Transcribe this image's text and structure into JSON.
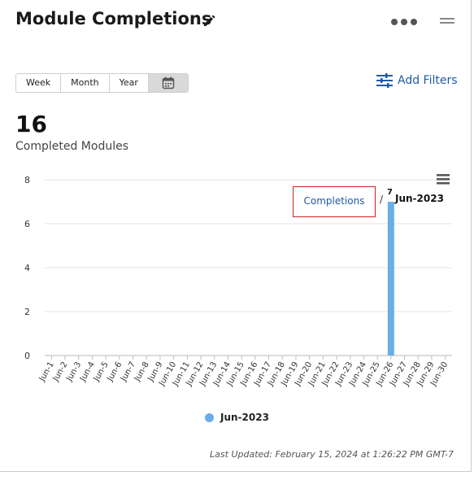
{
  "widget": {
    "title": "Module Completions",
    "icons": {
      "edit": "pencil-icon",
      "more": "more-horizontal-icon",
      "drag": "drag-handle-icon",
      "calendar": "calendar-icon",
      "filters": "sliders-icon",
      "chart_menu": "hamburger-menu-icon"
    }
  },
  "period_selector": {
    "week": "Week",
    "month": "Month",
    "year": "Year",
    "selected": "calendar"
  },
  "filters": {
    "label": "Add Filters"
  },
  "summary": {
    "value": "16",
    "label": "Completed Modules"
  },
  "tooltip": {
    "series": "Completions",
    "separator": "/",
    "period": "Jun-2023"
  },
  "bar_data_label": "7",
  "legend": {
    "label": "Jun-2023",
    "color": "#6aaee8"
  },
  "last_updated": "Last Updated: February 15, 2024 at 1:26:22 PM GMT-7",
  "chart_data": {
    "type": "bar",
    "title": "",
    "xlabel": "",
    "ylabel": "",
    "ylim": [
      0,
      8
    ],
    "yticks": [
      "0",
      "2",
      "4",
      "6",
      "8"
    ],
    "grid": true,
    "legend_position": "bottom",
    "categories": [
      "Jun-1",
      "Jun-2",
      "Jun-3",
      "Jun-4",
      "Jun-5",
      "Jun-6",
      "Jun-7",
      "Jun-8",
      "Jun-9",
      "Jun-10",
      "Jun-11",
      "Jun-12",
      "Jun-13",
      "Jun-14",
      "Jun-15",
      "Jun-16",
      "Jun-17",
      "Jun-18",
      "Jun-19",
      "Jun-20",
      "Jun-21",
      "Jun-22",
      "Jun-23",
      "Jun-24",
      "Jun-25",
      "Jun-26",
      "Jun-27",
      "Jun-28",
      "Jun-29",
      "Jun-30"
    ],
    "series": [
      {
        "name": "Jun-2023",
        "color": "#6aaee8",
        "values": [
          0,
          0,
          0,
          0,
          0,
          0,
          0,
          0,
          0,
          0,
          0,
          0,
          0,
          0,
          0,
          0,
          0,
          0,
          0,
          0,
          0,
          0,
          0,
          0,
          0,
          7,
          0,
          0,
          0,
          0
        ]
      }
    ]
  }
}
